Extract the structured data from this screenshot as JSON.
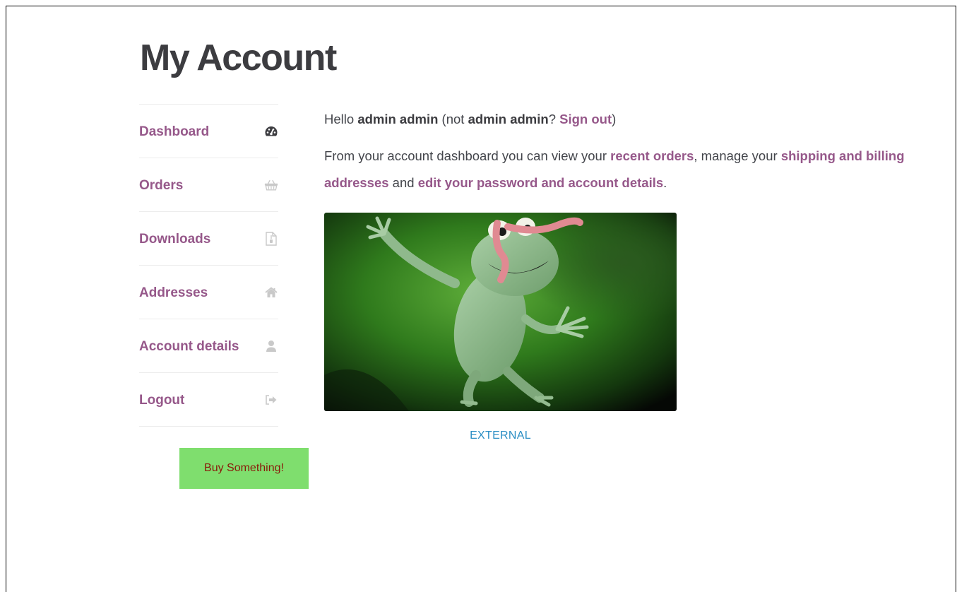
{
  "page": {
    "title": "My Account"
  },
  "nav": {
    "items": [
      {
        "label": "Dashboard",
        "icon": "dashboard-icon"
      },
      {
        "label": "Orders",
        "icon": "basket-icon"
      },
      {
        "label": "Downloads",
        "icon": "file-download-icon"
      },
      {
        "label": "Addresses",
        "icon": "home-icon"
      },
      {
        "label": "Account details",
        "icon": "user-icon"
      },
      {
        "label": "Logout",
        "icon": "sign-out-icon"
      }
    ]
  },
  "buy_button": {
    "label": "Buy Something!"
  },
  "dashboard": {
    "hello": "Hello ",
    "user_name": "admin admin",
    "not_open": " (not ",
    "not_user": "admin admin",
    "question": "? ",
    "sign_out": "Sign out",
    "close_paren": ")",
    "intro_1": "From your account dashboard you can view your ",
    "recent_orders": "recent orders",
    "intro_2": ", manage your ",
    "addresses_link": "shipping and billing addresses",
    "intro_3": " and ",
    "account_link": "edit your password and account details",
    "intro_4": "."
  },
  "image": {
    "subject": "cartoon frog with worm"
  },
  "external_link": {
    "label": "EXTERNAL"
  },
  "colors": {
    "accent": "#96588a",
    "button_bg": "#7fde6e",
    "button_text": "#8a1a0a",
    "external_link": "#2a8ec4"
  }
}
